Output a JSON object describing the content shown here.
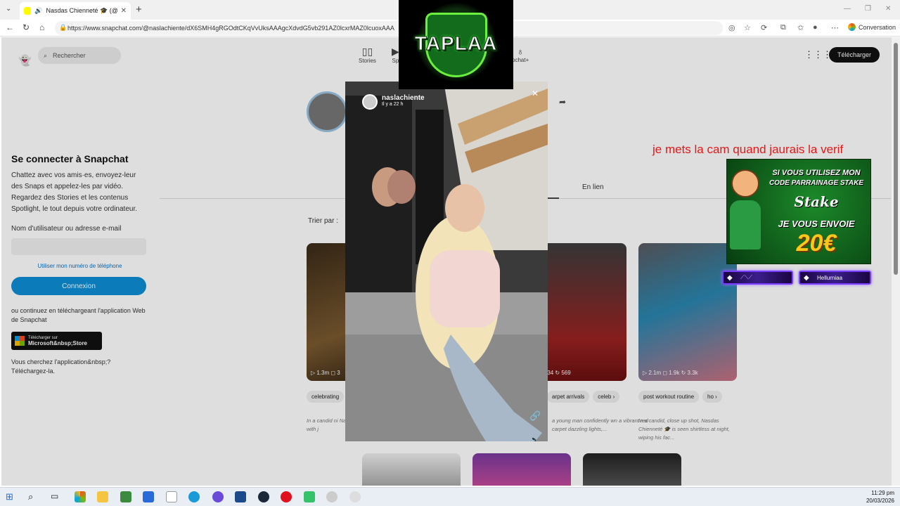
{
  "browser": {
    "tab_title": "Nasdas Chienneté 🎓 (@nasl",
    "tab_close": "✕",
    "url": "https://www.snapchat.com/@naslachiente/dX6SMH4gRGOdtCKqVvUksAAAgcXdvdG5vb291AZ0lcxrMAZ0lcuoxAAA",
    "conversation_label": "Conversation"
  },
  "snapchat": {
    "search_placeholder": "Rechercher",
    "nav": [
      {
        "label": "Stories"
      },
      {
        "label": "Sp"
      },
      {
        "label": "pchat+"
      }
    ],
    "download_button": "Télécharger",
    "login": {
      "title": "Se connecter à Snapchat",
      "description": "Chattez avec vos amis·es, envoyez-leur des Snaps et appelez-les par vidéo. Regardez des Stories et les contenus Spotlight, le tout depuis votre ordinateur.",
      "username_label": "Nom d'utilisateur ou adresse e-mail",
      "phone_link": "Utiliser mon numéro de téléphone",
      "connect_button": "Connexion",
      "or_text": "ou continuez en téléchargeant l'application Web de Snapchat",
      "store_small": "Télécharger sur",
      "store_big": "Microsoft&nbsp;Store",
      "help_text": "Vous cherchez l'application&nbsp;? Téléchargez-la."
    },
    "profile_tab": "En lien",
    "sort_label": "Trier par :",
    "cards": [
      {
        "stats": "▷ 1.3m  ◻ 3",
        "chips": [
          "celebrating"
        ],
        "caption": "In a candid ni Nasdas Chienn a victory with j"
      },
      {
        "stats": "◻ 634  ↻ 569",
        "chips": [
          "arpet arrivals",
          "celeb ›"
        ],
        "caption": "a young man confidently wn a vibrant red carpet dazzling lights,..."
      },
      {
        "stats": "▷ 2.1m  ◻ 1.9k  ↻ 3.3k",
        "chips": [
          "post workout routine",
          "ho ›"
        ],
        "caption": "In a candid, close up shot, Nasdas Chienneté 🎓 is seen shirtless at night, wiping his fac..."
      }
    ],
    "story": {
      "username": "naslachiente",
      "time": "Il y a 22 h"
    }
  },
  "stream": {
    "logo_text": "TAPLAA",
    "cam_message": "je mets la cam quand jaurais la verif",
    "stake_banner": {
      "line1": "SI VOUS UTILISEZ MON",
      "line2": "CODE PARRAINAGE STAKE",
      "brand": "Stake",
      "line3": "JE VOUS ENVOIE",
      "amount": "20€"
    },
    "neon_label_right": "Hellurniaa"
  },
  "taskbar": {
    "time": "11:29 pm",
    "date": "20/03/2026"
  },
  "colors": {
    "snap_blue": "#0e8ed6",
    "cam_red": "#e51717",
    "stake_green": "#1c8a2a"
  }
}
